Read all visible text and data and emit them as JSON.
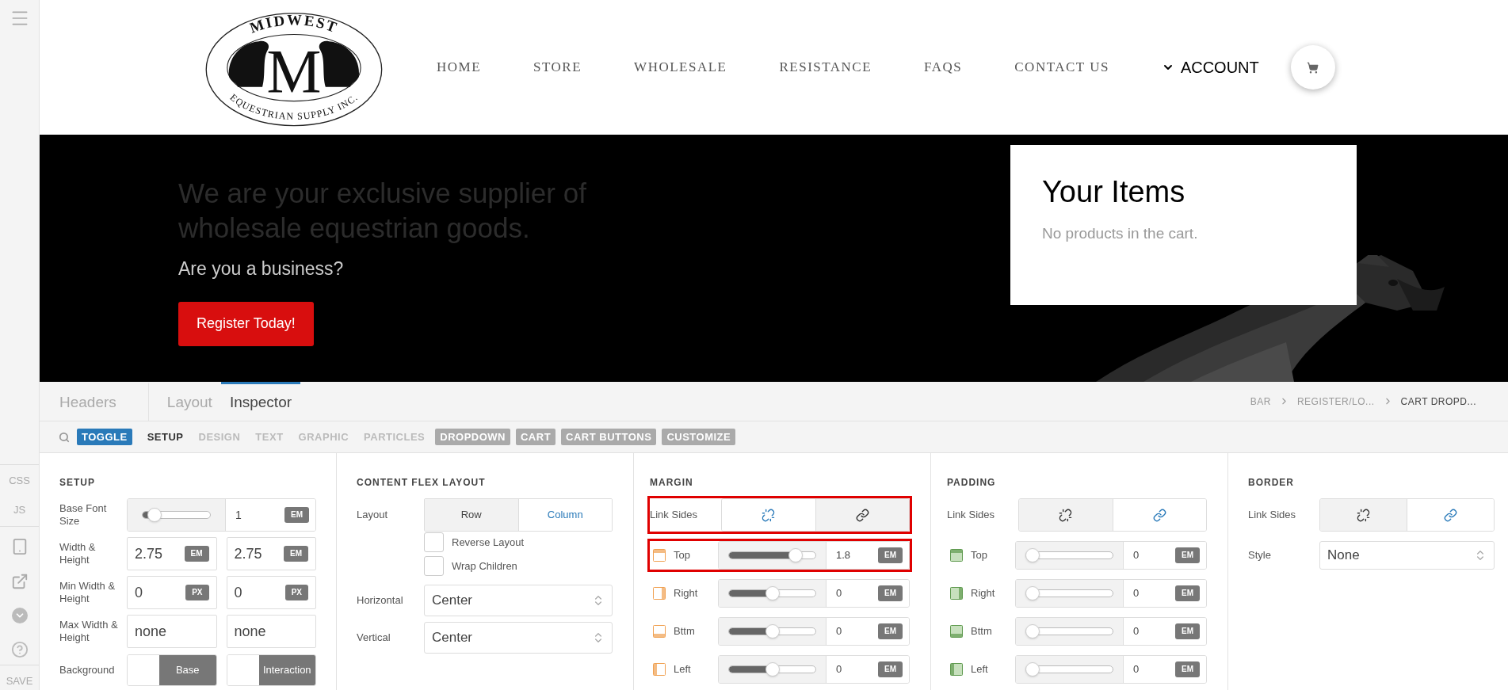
{
  "sidebar": {
    "code_tabs": [
      "CSS",
      "JS"
    ],
    "save": "SAVE"
  },
  "logo": {
    "top": "MIDWEST",
    "letter": "M",
    "bottom": "EQUESTRIAN SUPPLY INC."
  },
  "nav": [
    {
      "label": "HOME",
      "kind": "link"
    },
    {
      "label": "STORE",
      "kind": "link"
    },
    {
      "label": "WHOLESALE",
      "kind": "link"
    },
    {
      "label": "RESISTANCE",
      "kind": "link"
    },
    {
      "label": "FAQS",
      "kind": "link"
    },
    {
      "label": "CONTACT US",
      "kind": "link"
    },
    {
      "label": "ACCOUNT",
      "kind": "dropdown"
    }
  ],
  "hero": {
    "headline": "We are your exclusive supplier of wholesale equestrian goods.",
    "subhead": "Are you a business?",
    "button": "Register Today!"
  },
  "cart": {
    "title": "Your Items",
    "message": "No products in the cart."
  },
  "inspector_tabs": [
    {
      "label": "Headers",
      "selected": false
    },
    {
      "label": "Layout",
      "selected": false
    },
    {
      "label": "Inspector",
      "selected": true
    }
  ],
  "breadcrumb": [
    "BAR",
    "REGISTER/LO...",
    "CART DROPD..."
  ],
  "toolbar": [
    {
      "label": "TOGGLE",
      "kind": "toggle",
      "selected": false
    },
    {
      "label": "SETUP",
      "kind": "tab",
      "selected": true
    },
    {
      "label": "DESIGN",
      "kind": "tab",
      "selected": false
    },
    {
      "label": "TEXT",
      "kind": "tab",
      "selected": false
    },
    {
      "label": "GRAPHIC",
      "kind": "tab",
      "selected": false
    },
    {
      "label": "PARTICLES",
      "kind": "tab",
      "selected": false
    },
    {
      "label": "DROPDOWN",
      "kind": "tag",
      "selected": false
    },
    {
      "label": "CART",
      "kind": "tag",
      "selected": false
    },
    {
      "label": "CART BUTTONS",
      "kind": "tag",
      "selected": false
    },
    {
      "label": "CUSTOMIZE",
      "kind": "tag",
      "selected": false
    }
  ],
  "setup": {
    "title": "SETUP",
    "rows": [
      {
        "kind": "slider",
        "label": "Base Font Size",
        "level": 0.1,
        "value": "1",
        "unit": "EM"
      },
      {
        "kind": "pair",
        "label": "Width & Height",
        "fields": [
          {
            "value": "2.75",
            "unit": "EM"
          },
          {
            "value": "2.75",
            "unit": "EM"
          }
        ]
      },
      {
        "kind": "pair",
        "label": "Min Width & Height",
        "fields": [
          {
            "value": "0",
            "unit": "PX"
          },
          {
            "value": "0",
            "unit": "PX"
          }
        ]
      },
      {
        "kind": "pair",
        "label": "Max Width & Height",
        "fields": [
          {
            "value": "none"
          },
          {
            "value": "none"
          }
        ]
      },
      {
        "kind": "swatches",
        "label": "Background",
        "swatches": [
          "Base",
          "Interaction"
        ]
      }
    ]
  },
  "flex": {
    "title": "CONTENT FLEX LAYOUT",
    "layout": {
      "label": "Layout",
      "options": [
        {
          "label": "Row",
          "selected": false
        },
        {
          "label": "Column",
          "selected": true
        }
      ]
    },
    "checkboxes": [
      {
        "label": "Reverse Layout",
        "checked": false
      },
      {
        "label": "Wrap Children",
        "checked": false
      }
    ],
    "selects": [
      {
        "label": "Horizontal",
        "value": "Center"
      },
      {
        "label": "Vertical",
        "value": "Center"
      }
    ]
  },
  "margin": {
    "title": "MARGIN",
    "link_sides": {
      "label": "Link Sides",
      "highlighted": true,
      "options": [
        {
          "selected": true
        },
        {
          "selected": false
        }
      ]
    },
    "sides": [
      {
        "label": "Top",
        "level": 0.82,
        "value": "1.8",
        "unit": "EM",
        "highlighted": true
      },
      {
        "label": "Right",
        "level": 0.5,
        "value": "0",
        "unit": "EM",
        "highlighted": false
      },
      {
        "label": "Bttm",
        "level": 0.5,
        "value": "0",
        "unit": "EM",
        "highlighted": false
      },
      {
        "label": "Left",
        "level": 0.5,
        "value": "0",
        "unit": "EM",
        "highlighted": false
      }
    ]
  },
  "padding": {
    "title": "PADDING",
    "link_sides": {
      "label": "Link Sides",
      "highlighted": false,
      "options": [
        {
          "selected": false
        },
        {
          "selected": true
        }
      ]
    },
    "sides": [
      {
        "label": "Top",
        "level": 0,
        "value": "0",
        "unit": "EM",
        "highlighted": false
      },
      {
        "label": "Right",
        "level": 0,
        "value": "0",
        "unit": "EM",
        "highlighted": false
      },
      {
        "label": "Bttm",
        "level": 0,
        "value": "0",
        "unit": "EM",
        "highlighted": false
      },
      {
        "label": "Left",
        "level": 0,
        "value": "0",
        "unit": "EM",
        "highlighted": false
      }
    ]
  },
  "border": {
    "title": "BORDER",
    "link_sides": {
      "label": "Link Sides",
      "highlighted": false,
      "options": [
        {
          "selected": false
        },
        {
          "selected": true
        }
      ]
    },
    "style": {
      "label": "Style",
      "value": "None"
    }
  }
}
